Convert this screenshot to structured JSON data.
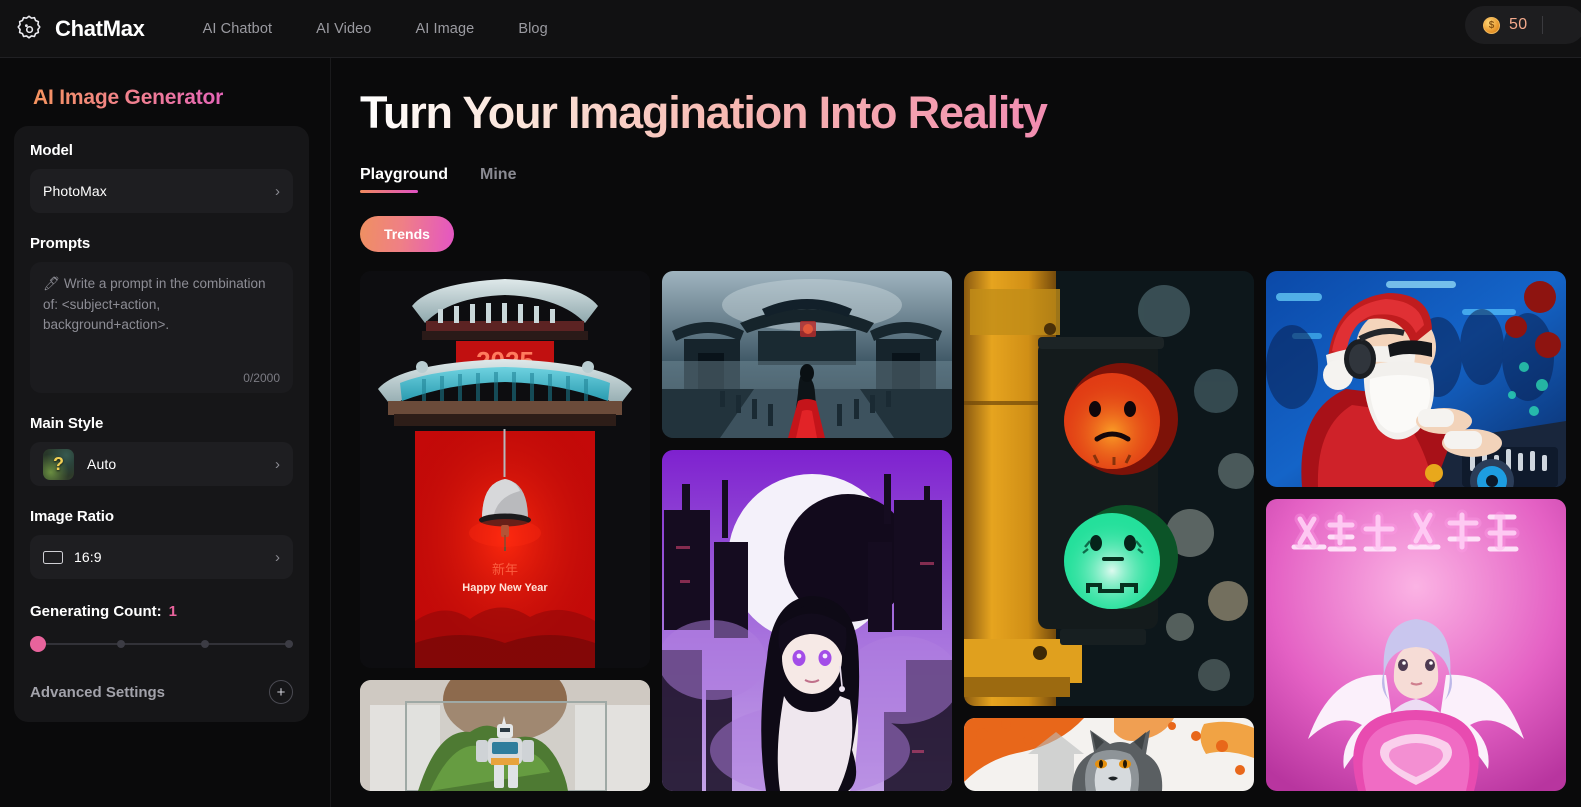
{
  "header": {
    "logo_icon": "chatmax-gear-logo",
    "brand": "ChatMax",
    "nav": [
      {
        "label": "AI Chatbot"
      },
      {
        "label": "AI Video"
      },
      {
        "label": "AI Image"
      },
      {
        "label": "Blog"
      }
    ],
    "credits": {
      "icon": "coin-icon",
      "coin_glyph": "$",
      "value": "50"
    }
  },
  "sidebar": {
    "title": "AI Image Generator",
    "model": {
      "label": "Model",
      "value": "PhotoMax",
      "chevron": "›"
    },
    "prompts": {
      "label": "Prompts",
      "placeholder": "🖊 Write a prompt in the combination of: <subject+action, background+action>.",
      "value": "",
      "counter": "0/2000"
    },
    "main_style": {
      "label": "Main Style",
      "value": "Auto",
      "thumb_glyph": "?",
      "chevron": "›"
    },
    "image_ratio": {
      "label": "Image Ratio",
      "value": "16:9",
      "icon": "rectangle-16-9-icon",
      "chevron": "›"
    },
    "generating_count": {
      "label": "Generating Count:",
      "value": "1",
      "slider_position_pct": 0,
      "ticks_pct": [
        0,
        34,
        67,
        100
      ]
    },
    "advanced_settings": {
      "label": "Advanced Settings",
      "toggle_glyph": "+"
    }
  },
  "main": {
    "hero_title": "Turn Your Imagination Into Reality",
    "tabs": [
      {
        "label": "Playground",
        "active": true
      },
      {
        "label": "Mine",
        "active": false
      }
    ],
    "chips": [
      {
        "label": "Trends",
        "active": true
      }
    ],
    "gallery": [
      {
        "name": "chinese-new-year-gate-2025",
        "alt": "Red temple gate with 2025 banner, hanging bell and Happy New Year text",
        "caption_year": "2025",
        "caption_text": "Happy New Year"
      },
      {
        "name": "gundam-terrarium",
        "alt": "Person holding glass terrarium with mecha robot on moss"
      },
      {
        "name": "misty-palace-red-robe",
        "alt": "Foggy blue ancient palace bridge with figure in red robe"
      },
      {
        "name": "purple-anime-girl-moon",
        "alt": "Purple cyberpunk cityscape with dark haired anime girl and large white moon"
      },
      {
        "name": "cute-traffic-light",
        "alt": "Traffic light on yellow pole with cute red sad face and green happy face"
      },
      {
        "name": "autumn-wolf",
        "alt": "Grey wolf among orange autumn maple leaves"
      },
      {
        "name": "dj-santa-claus",
        "alt": "Santa Claus with headphones and sunglasses DJing at a blue-lit party"
      },
      {
        "name": "pink-neon-angel",
        "alt": "Angel girl with silver hair and wings holding pink heart balloon under neon sign"
      }
    ]
  },
  "colors": {
    "page_bg": "#0a0a0b",
    "header_bg": "#111112",
    "card_bg": "#161618",
    "accent_pink": "#e8639c",
    "accent_orange": "#ef9061",
    "accent_magenta": "#e455c4",
    "credit_text": "#f2a98b"
  }
}
